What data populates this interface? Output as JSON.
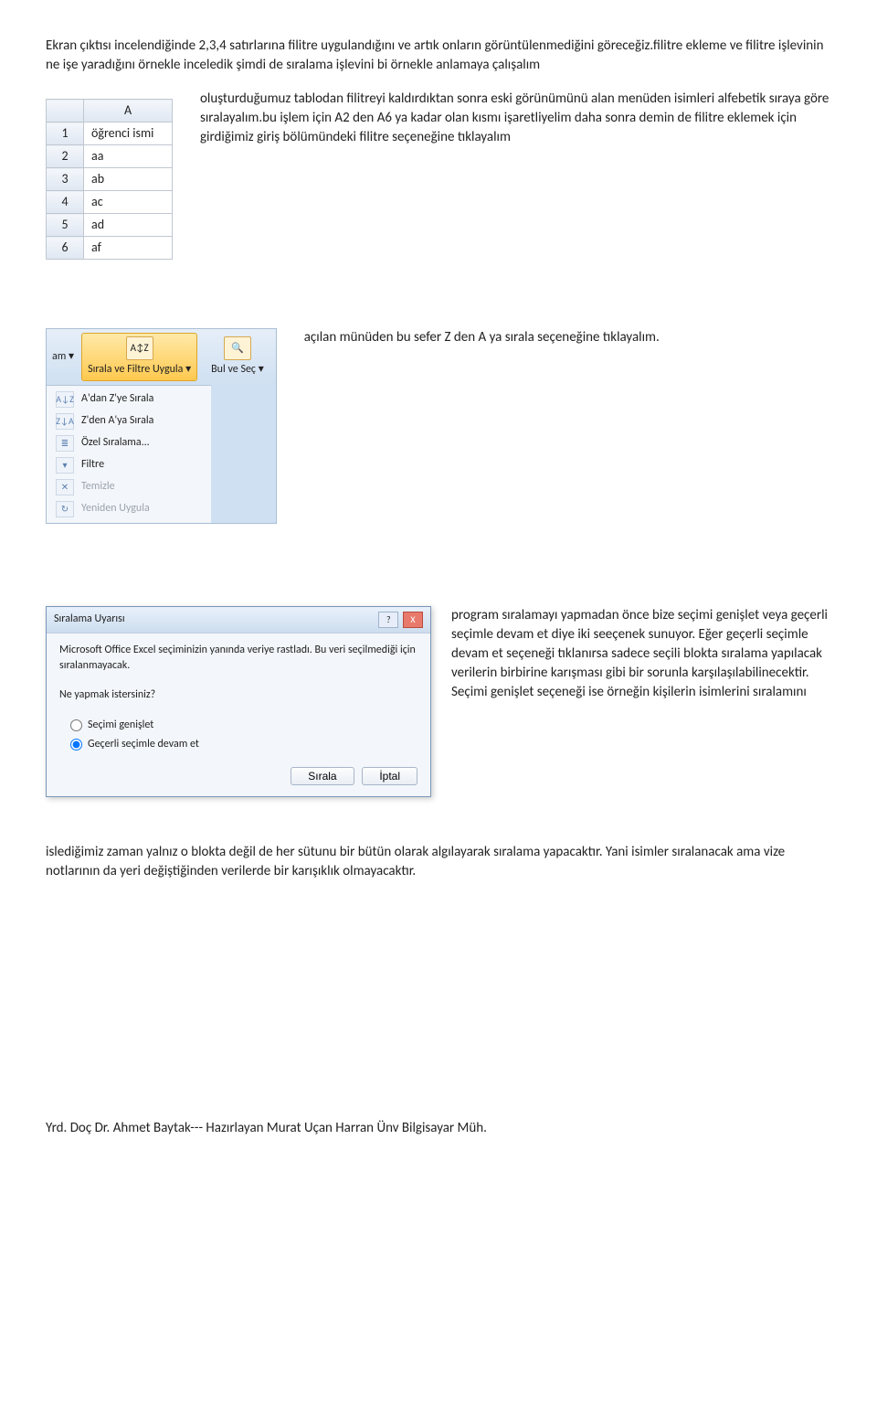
{
  "intro": {
    "p1": "Ekran çıktısı incelendiğinde 2,3,4 satırlarına filitre uygulandığını ve artık onların görüntülenmediğini göreceğiz.filitre ekleme ve filitre işlevinin ne işe yaradığını örnekle inceledik şimdi de sıralama işlevini bi örnekle anlamaya çalışalım"
  },
  "excel": {
    "col_header": "A",
    "rows": [
      {
        "n": "1",
        "v": "öğrenci ismi"
      },
      {
        "n": "2",
        "v": "aa"
      },
      {
        "n": "3",
        "v": "ab"
      },
      {
        "n": "4",
        "v": "ac"
      },
      {
        "n": "5",
        "v": "ad"
      },
      {
        "n": "6",
        "v": "af"
      }
    ],
    "side_text": "oluşturduğumuz tablodan filitreyi kaldırdıktan sonra eski görünümünü alan menüden isimleri alfebetik sıraya göre sıralayalım.bu işlem için A2 den A6 ya kadar olan kısmı işaretliyelim daha sonra demin de filitre eklemek için girdiğimiz giriş bölümündeki filitre seçeneğine tıklayalım"
  },
  "ribbon": {
    "left_label": "am ▾",
    "btn_sort_label": "Sırala ve Filtre Uygula ▾",
    "btn_find_label": "Bul ve Seç ▾",
    "sort_icon_text": "A↕Z",
    "find_icon_text": "🔍",
    "menu": {
      "az": "A'dan Z'ye Sırala",
      "za": "Z'den A'ya Sırala",
      "custom": "Özel Sıralama...",
      "filter": "Filtre",
      "clear": "Temizle",
      "reapply": "Yeniden Uygula"
    },
    "az_icon": "A↓Z",
    "za_icon": "Z↓A",
    "custom_icon": "≣",
    "filter_icon": "▾",
    "clear_icon": "✕",
    "reapply_icon": "↻",
    "side_text": "açılan münüden bu sefer Z den A ya sırala seçeneğine tıklayalım."
  },
  "dialog": {
    "title": "Sıralama Uyarısı",
    "help": "?",
    "close": "X",
    "msg": "Microsoft Office Excel seçiminizin yanında veriye rastladı. Bu veri seçilmediği için sıralanmayacak.",
    "question": "Ne yapmak istersiniz?",
    "opt_expand": "Seçimi genişlet",
    "opt_continue": "Geçerli seçimle devam et",
    "btn_sort": "Sırala",
    "btn_cancel": "İptal",
    "side_text_a": "program sıralamayı yapmadan önce bize seçimi genişlet veya geçerli seçimle devam et diye iki seeçenek sunuyor. Eğer geçerli seçimle devam et seçeneği tıklanırsa sadece seçili blokta sıralama yapılacak verilerin birbirine karışması gibi bir sorunla karşılaşılabilinecektir. Seçimi genişlet seçeneği ise örneğin kişilerin isimlerini sıralamını"
  },
  "after_dialog": "islediğimiz zaman yalnız o blokta değil de her sütunu bir bütün olarak algılayarak sıralama yapacaktır. Yani isimler sıralanacak ama vize notlarının da yeri değiştiğinden verilerde bir karışıklık olmayacaktır.",
  "footer": "Yrd. Doç Dr. Ahmet Baytak--- Hazırlayan Murat Uçan Harran Ünv Bilgisayar Müh."
}
